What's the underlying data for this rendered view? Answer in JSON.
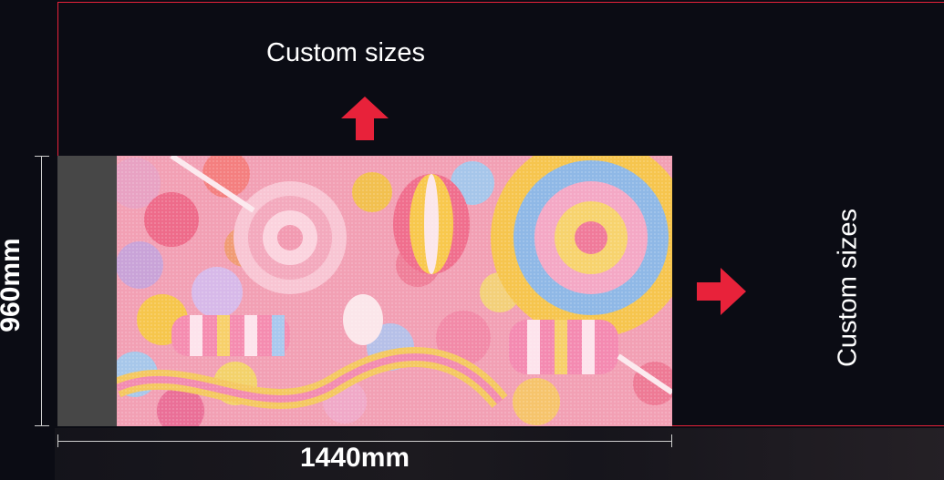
{
  "labels": {
    "top": "Custom sizes",
    "right": "Custom sizes",
    "width": "1440mm",
    "height": "960mm"
  },
  "colors": {
    "accent": "#e8223a",
    "background": "#0b0c14",
    "panel_side": "#474747",
    "text": "#ffffff"
  },
  "icons": {
    "up": "arrow-up-icon",
    "right": "arrow-right-icon"
  }
}
